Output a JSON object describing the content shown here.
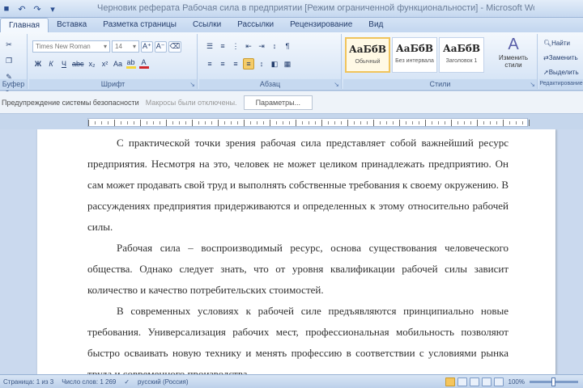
{
  "window": {
    "title": "Черновик реферата Рабочая сила в предприятии [Режим ограниченной функциональности] - Microsoft Word"
  },
  "quick_access": {
    "icons": [
      "save-icon",
      "undo-icon",
      "redo-icon",
      "dropdown-icon"
    ]
  },
  "tabs": [
    {
      "label": "Главная",
      "active": true
    },
    {
      "label": "Вставка",
      "active": false
    },
    {
      "label": "Разметка страницы",
      "active": false
    },
    {
      "label": "Ссылки",
      "active": false
    },
    {
      "label": "Рассылки",
      "active": false
    },
    {
      "label": "Рецензирование",
      "active": false
    },
    {
      "label": "Вид",
      "active": false
    }
  ],
  "ribbon": {
    "clipboard": {
      "label": "Буфер обмена"
    },
    "font": {
      "label": "Шрифт",
      "font_name": "Times New Roman",
      "font_size": "14",
      "highlight_color": "#f5d63a",
      "font_color": "#d1262a"
    },
    "paragraph": {
      "label": "Абзац"
    },
    "styles": {
      "label": "Стили",
      "items": [
        {
          "preview": "АаБбВ",
          "name": "Обычный",
          "selected": true
        },
        {
          "preview": "АаБбВ",
          "name": "Без интервала",
          "selected": false
        },
        {
          "preview": "АаБбВ",
          "name": "Заголовок 1",
          "selected": false
        }
      ],
      "change_styles_label": "Изменить стили"
    },
    "editing": {
      "label": "Редактирование",
      "items": [
        "Найти",
        "Заменить",
        "Выделить"
      ]
    }
  },
  "message_bar": {
    "strong_text": "Предупреждение системы безопасности",
    "soft_text": "Макросы были отключены.",
    "button_label": "Параметры..."
  },
  "document": {
    "paragraphs": [
      "С практической точки зрения рабочая сила представляет собой важнейший ресурс предприятия. Несмотря на это, человек не может целиком принадлежать предприятию. Он сам может продавать свой труд и выполнять собственные требования к своему окружению. В рассуждениях предприятия придерживаются и определенных к этому относительно рабочей силы.",
      "Рабочая сила – воспроизводимый ресурс, основа существования человеческого общества. Однако следует знать, что от уровня квалификации рабочей силы зависит количество и качество потребительских стоимостей.",
      "В современных условиях к рабочей силе предъявляются принципиально новые требования. Универсализация рабочих мест, профессиональная мобильность позволяют быстро осваивать новую технику и менять профессию в соответствии с условиями рынка труда и современного производства."
    ]
  },
  "status_bar": {
    "page": "Страница: 1 из 3",
    "words": "Число слов: 1 269",
    "language": "русский (Россия)",
    "zoom": "100%",
    "zoom_level": 0.5
  }
}
